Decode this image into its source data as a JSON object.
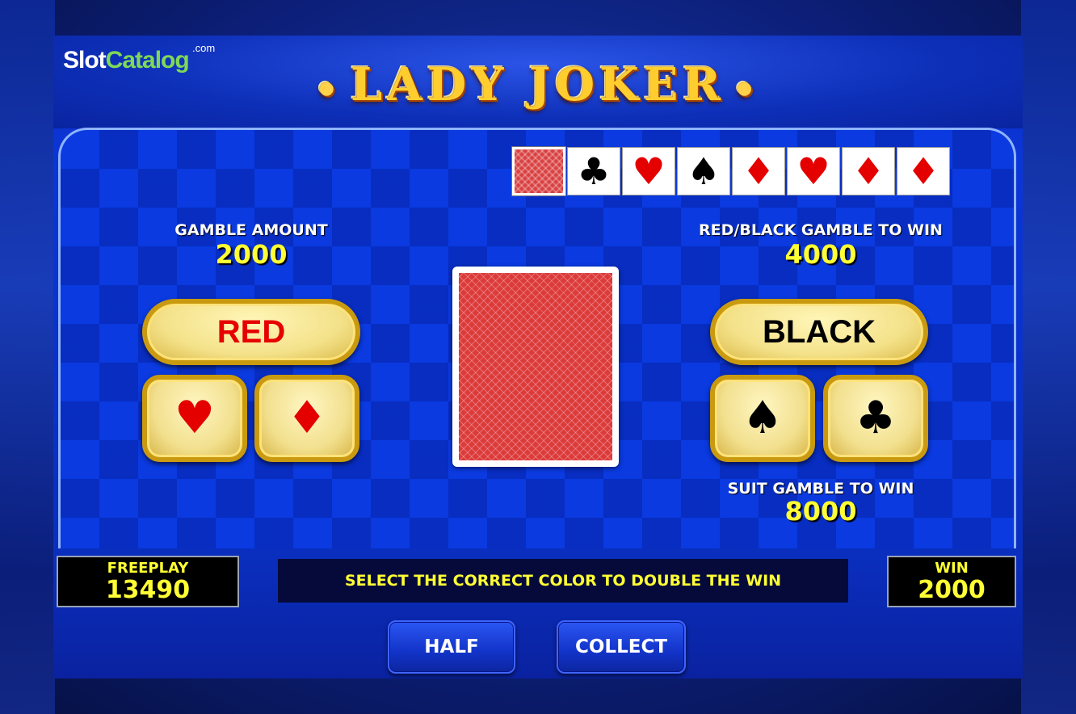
{
  "logo": {
    "slot": "Slot",
    "catalog": "Catalog",
    "com": ".com"
  },
  "title": "LADY JOKER",
  "history": [
    {
      "suit": "back",
      "glyph": ""
    },
    {
      "suit": "club",
      "glyph": "♣",
      "color": "black"
    },
    {
      "suit": "heart",
      "glyph": "♥",
      "color": "red"
    },
    {
      "suit": "spade",
      "glyph": "♠",
      "color": "black"
    },
    {
      "suit": "diamond",
      "glyph": "♦",
      "color": "red"
    },
    {
      "suit": "heart",
      "glyph": "♥",
      "color": "red"
    },
    {
      "suit": "diamond",
      "glyph": "♦",
      "color": "red"
    },
    {
      "suit": "diamond",
      "glyph": "♦",
      "color": "red"
    }
  ],
  "gamble_amount": {
    "label": "GAMBLE AMOUNT",
    "value": "2000"
  },
  "color_gamble": {
    "label": "RED/BLACK GAMBLE TO WIN",
    "value": "4000"
  },
  "suit_gamble": {
    "label": "SUIT GAMBLE TO WIN",
    "value": "8000"
  },
  "buttons": {
    "red": "RED",
    "black": "BLACK",
    "heart": "♥",
    "diamond": "♦",
    "spade": "♠",
    "club": "♣",
    "half": "HALF",
    "collect": "COLLECT"
  },
  "freeplay": {
    "label": "FREEPLAY",
    "value": "13490"
  },
  "win": {
    "label": "WIN",
    "value": "2000"
  },
  "message": "SELECT THE CORRECT COLOR TO DOUBLE THE WIN",
  "colors": {
    "accent_yellow": "#ffff33",
    "panel_blue": "#0a3ae0",
    "gold": "#c99a10",
    "card_red": "#dd3a3a"
  }
}
